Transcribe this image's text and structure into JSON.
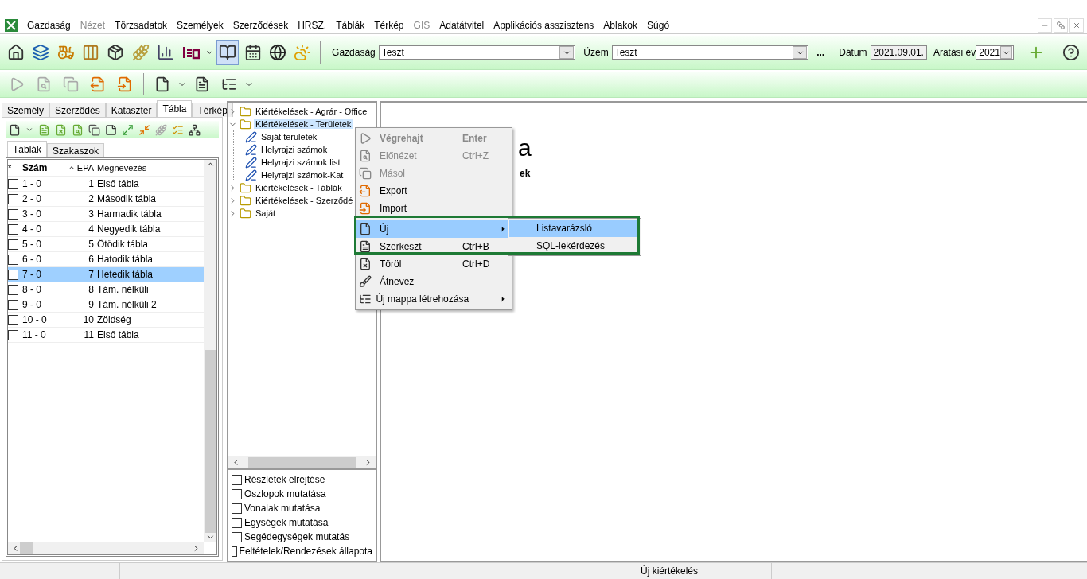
{
  "menubar": [
    {
      "label": "Gazdaság",
      "disabled": false
    },
    {
      "label": "Nézet",
      "disabled": true
    },
    {
      "label": "Törzsadatok",
      "disabled": false
    },
    {
      "label": "Személyek",
      "disabled": false
    },
    {
      "label": "Szerződések",
      "disabled": false
    },
    {
      "label": "HRSZ.",
      "disabled": false
    },
    {
      "label": "Táblák",
      "disabled": false
    },
    {
      "label": "Térkép",
      "disabled": false
    },
    {
      "label": "GIS",
      "disabled": true
    },
    {
      "label": "Adatátvitel",
      "disabled": false
    },
    {
      "label": "Applikációs asszisztens",
      "disabled": false
    },
    {
      "label": "Ablakok",
      "disabled": false
    },
    {
      "label": "Súgó",
      "disabled": false
    }
  ],
  "toolbar": {
    "buttons": [
      {
        "selected": false
      },
      {
        "selected": false
      },
      {
        "selected": false
      },
      {
        "selected": false
      },
      {
        "selected": false
      },
      {
        "selected": false
      },
      {
        "selected": false
      },
      {
        "selected": false
      },
      {
        "selected": true
      },
      {
        "selected": false
      },
      {
        "selected": false
      },
      {
        "selected": false
      }
    ],
    "farm_label": "Gazdaság",
    "farm": "Teszt",
    "site_label": "Üzem",
    "site": "Teszt",
    "more": "...",
    "date_label": "Dátum",
    "date": "2021.09.01.",
    "year_label": "Aratási év",
    "year": "2021"
  },
  "actions_toolbar": [
    {
      "disabled": true
    },
    {
      "disabled": true
    },
    {
      "disabled": true
    },
    {
      "disabled": false
    },
    {
      "disabled": false
    },
    {
      "disabled": false
    },
    {
      "disabled": false
    },
    {
      "disabled": false
    }
  ],
  "left_panel": {
    "tabs": [
      {
        "label": "Személy",
        "selected": false
      },
      {
        "label": "Szerződés",
        "selected": false
      },
      {
        "label": "Kataszter",
        "selected": false
      },
      {
        "label": "Tábla",
        "selected": true
      },
      {
        "label": "Térkép",
        "selected": false
      }
    ],
    "subtabs": [
      {
        "label": "Táblák",
        "selected": true
      },
      {
        "label": "Szakaszok",
        "selected": false
      }
    ],
    "table": {
      "columns": [
        "*",
        "Szám",
        "EPA",
        "Megnevezés"
      ],
      "rows": [
        {
          "checked": false,
          "selected": false,
          "number": "1 - 0",
          "epa": "1",
          "name": "Első tábla"
        },
        {
          "checked": false,
          "selected": false,
          "number": "2 - 0",
          "epa": "2",
          "name": "Második tábla"
        },
        {
          "checked": false,
          "selected": false,
          "number": "3 - 0",
          "epa": "3",
          "name": "Harmadik tábla"
        },
        {
          "checked": false,
          "selected": false,
          "number": "4 - 0",
          "epa": "4",
          "name": "Negyedik tábla"
        },
        {
          "checked": false,
          "selected": false,
          "number": "5 - 0",
          "epa": "5",
          "name": "Ötödik tábla"
        },
        {
          "checked": false,
          "selected": false,
          "number": "6 - 0",
          "epa": "6",
          "name": "Hatodik tábla"
        },
        {
          "checked": false,
          "selected": true,
          "number": "7 - 0",
          "epa": "7",
          "name": "Hetedik tábla"
        },
        {
          "checked": false,
          "selected": false,
          "number": "8 - 0",
          "epa": "8",
          "name": "Tám. nélküli"
        },
        {
          "checked": false,
          "selected": false,
          "number": "9 - 0",
          "epa": "9",
          "name": "Tám. nélküli 2"
        },
        {
          "checked": false,
          "selected": false,
          "number": "10 - 0",
          "epa": "10",
          "name": "Zöldség"
        },
        {
          "checked": false,
          "selected": false,
          "number": "11 - 0",
          "epa": "11",
          "name": "Első tábla"
        }
      ]
    }
  },
  "tree": [
    {
      "kind": "folder",
      "label": "Kiértékelések - Agrár - Office",
      "expanded": false,
      "selected": false
    },
    {
      "kind": "folder",
      "label": "Kiértékelések - Területek",
      "expanded": true,
      "selected": true,
      "children": [
        {
          "kind": "report",
          "label": "Saját területek",
          "selected": false
        },
        {
          "kind": "report",
          "label": "Helyrajzi számok",
          "selected": false
        },
        {
          "kind": "report",
          "label": "Helyrajzi számok list",
          "selected": false
        },
        {
          "kind": "report",
          "label": "Helyrajzi számok-Kat",
          "selected": false
        }
      ]
    },
    {
      "kind": "folder",
      "label": "Kiértékelések - Táblák",
      "expanded": false,
      "selected": false
    },
    {
      "kind": "folder",
      "label": "Kiértékelések - Szerződé",
      "expanded": false,
      "selected": false
    },
    {
      "kind": "folder",
      "label": "Saját",
      "expanded": false,
      "selected": false
    }
  ],
  "options": [
    {
      "label": "Részletek elrejtése",
      "checked": false
    },
    {
      "label": "Oszlopok mutatása",
      "checked": false
    },
    {
      "label": "Vonalak mutatása",
      "checked": false
    },
    {
      "label": "Egységek mutatása",
      "checked": false
    },
    {
      "label": "Segédegységek mutatás",
      "checked": false
    },
    {
      "label": "Feltételek/Rendezések állapota",
      "checked": false
    }
  ],
  "content": {
    "title_fragment": "a",
    "text_fragment": "ek"
  },
  "context_menu": [
    {
      "label": "Végrehajt",
      "shortcut": "Enter",
      "disabled": true,
      "bold": true,
      "selected": false,
      "submenu": false
    },
    {
      "label": "Előnézet",
      "shortcut": "Ctrl+Z",
      "disabled": true,
      "bold": false,
      "selected": false,
      "submenu": false
    },
    {
      "label": "Másol",
      "disabled": true,
      "bold": false,
      "selected": false,
      "submenu": false
    },
    {
      "label": "Export",
      "disabled": false,
      "bold": false,
      "selected": false,
      "submenu": false
    },
    {
      "label": "Import",
      "disabled": false,
      "bold": false,
      "selected": false,
      "submenu": false
    },
    {
      "label": "Új",
      "disabled": false,
      "bold": false,
      "selected": true,
      "submenu": true,
      "separator": true
    },
    {
      "label": "Szerkeszt",
      "shortcut": "Ctrl+B",
      "disabled": false,
      "bold": false,
      "selected": false,
      "submenu": false
    },
    {
      "label": "Töröl",
      "shortcut": "Ctrl+D",
      "disabled": false,
      "bold": false,
      "selected": false,
      "submenu": false
    },
    {
      "label": "Átnevez",
      "disabled": false,
      "bold": false,
      "selected": false,
      "submenu": false
    },
    {
      "label": "Új mappa létrehozása",
      "disabled": false,
      "bold": false,
      "selected": false,
      "submenu": true
    }
  ],
  "submenu": [
    {
      "label": "Listavarázsló",
      "selected": true
    },
    {
      "label": "SQL-lekérdezés",
      "selected": false
    }
  ],
  "status_bar": {
    "text": "Új kiértékelés"
  }
}
